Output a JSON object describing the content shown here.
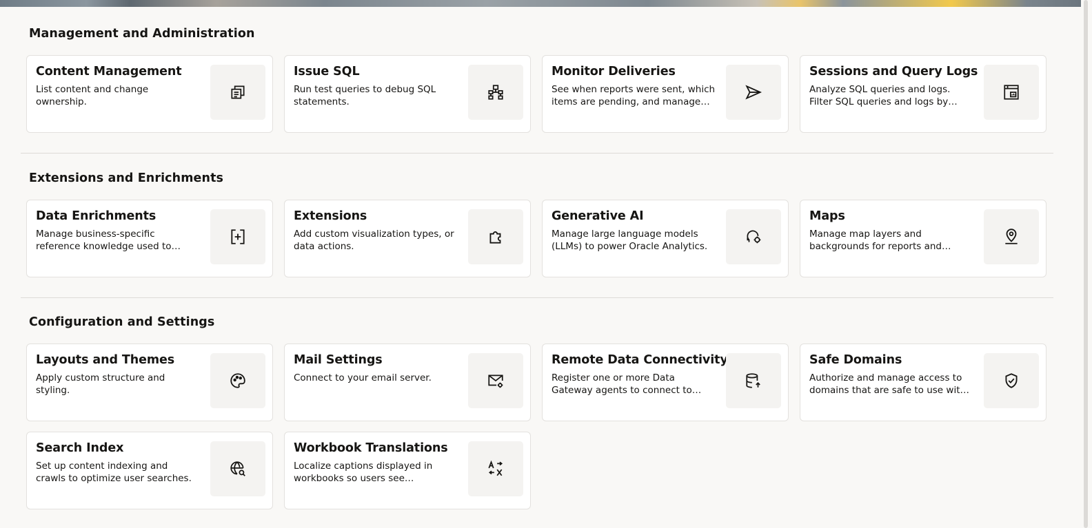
{
  "sections": [
    {
      "title": "Management and Administration",
      "cards": [
        {
          "title": "Content Management",
          "desc": "List content and change ownership.",
          "icon": "content-management-icon"
        },
        {
          "title": "Issue SQL",
          "desc": "Run test queries to debug SQL statements.",
          "icon": "sql-hierarchy-icon"
        },
        {
          "title": "Monitor Deliveries",
          "desc": "See when reports were sent, which items are pending, and manage your deliveries.",
          "icon": "send-icon"
        },
        {
          "title": "Sessions and Query Logs",
          "desc": "Analyze SQL queries and logs. Filter SQL queries and logs by user.",
          "icon": "session-log-icon"
        }
      ]
    },
    {
      "title": "Extensions and Enrichments",
      "cards": [
        {
          "title": "Data Enrichments",
          "desc": "Manage business-specific reference knowledge used to classify datasets.",
          "icon": "data-enrichment-icon"
        },
        {
          "title": "Extensions",
          "desc": "Add custom visualization types, or data actions.",
          "icon": "puzzle-icon"
        },
        {
          "title": "Generative AI",
          "desc": "Manage large language models (LLMs) to power Oracle Analytics.",
          "icon": "generative-ai-icon"
        },
        {
          "title": "Maps",
          "desc": "Manage map layers and backgrounds for reports and dashboards, so users can visualize data.",
          "icon": "map-pin-icon"
        }
      ]
    },
    {
      "title": "Configuration and Settings",
      "cards": [
        {
          "title": "Layouts and Themes",
          "desc": "Apply custom structure and styling.",
          "icon": "palette-icon"
        },
        {
          "title": "Mail Settings",
          "desc": "Connect to your email server.",
          "icon": "mail-settings-icon"
        },
        {
          "title": "Remote Data Connectivity",
          "desc": "Register one or more Data Gateway agents to connect to remote on-premises data.",
          "icon": "database-upload-icon"
        },
        {
          "title": "Safe Domains",
          "desc": "Authorize and manage access to domains that are safe to use with Oracle Analytics.",
          "icon": "shield-check-icon"
        },
        {
          "title": "Search Index",
          "desc": "Set up content indexing and crawls to optimize user searches.",
          "icon": "globe-search-icon"
        },
        {
          "title": "Workbook Translations",
          "desc": "Localize captions displayed in workbooks so users see translations in their language.",
          "icon": "translate-icon"
        }
      ]
    }
  ]
}
